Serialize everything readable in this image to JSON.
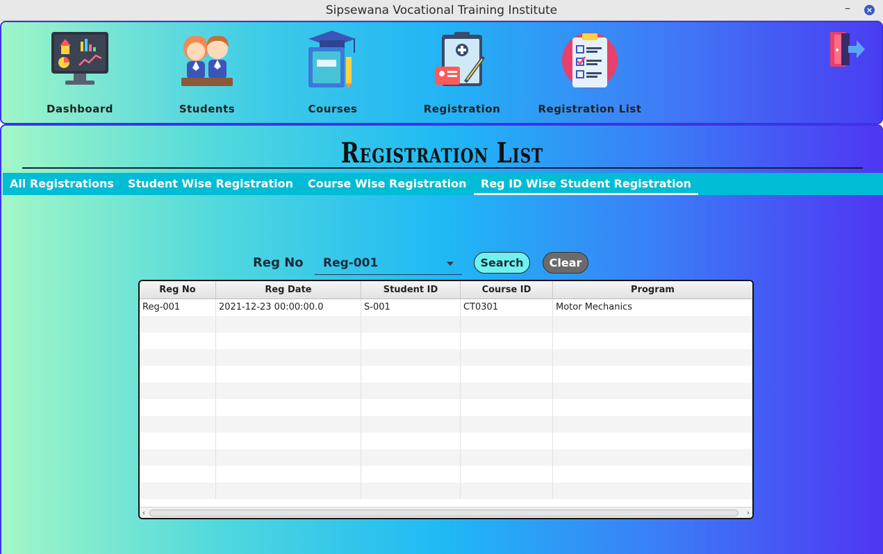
{
  "window": {
    "title": "Sipsewana Vocational Training Institute",
    "minimize": "–",
    "close": "×"
  },
  "nav": {
    "items": [
      {
        "label": "Dashboard",
        "icon": "dashboard-monitor-icon"
      },
      {
        "label": "Students",
        "icon": "students-icon"
      },
      {
        "label": "Courses",
        "icon": "courses-books-icon"
      },
      {
        "label": "Registration",
        "icon": "registration-clipboard-icon"
      },
      {
        "label": "Registration List",
        "icon": "registration-list-icon"
      }
    ],
    "exit_icon": "exit-door-icon"
  },
  "page": {
    "heading": "Registration List"
  },
  "tabs": [
    {
      "label": "All Registrations",
      "active": false
    },
    {
      "label": "Student Wise Registration",
      "active": false
    },
    {
      "label": "Course Wise Registration",
      "active": false
    },
    {
      "label": "Reg ID Wise Student Registration",
      "active": true
    }
  ],
  "filter": {
    "label": "Reg No",
    "selected": "Reg-001",
    "search_label": "Search",
    "clear_label": "Clear"
  },
  "table": {
    "columns": [
      "Reg No",
      "Reg Date",
      "Student ID",
      "Course ID",
      "Program"
    ],
    "rows": [
      [
        "Reg-001",
        "2021-12-23 00:00:00.0",
        "S-001",
        "CT0301",
        "Motor Mechanics"
      ]
    ]
  },
  "colors": {
    "accent_tab": "#00bcd4",
    "search_button": "#6ff2ee",
    "clear_button": "#6b6b6b",
    "panel_border": "#3b33e8"
  }
}
